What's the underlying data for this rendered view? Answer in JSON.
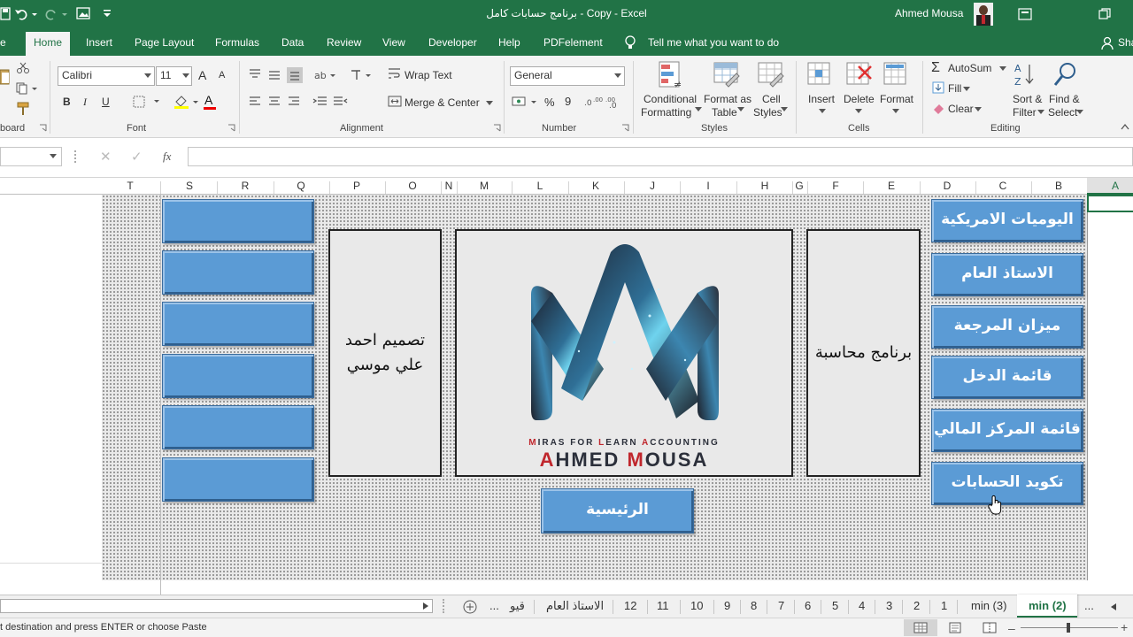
{
  "window": {
    "title": "برنامج حسابات كامل - Copy  -  Excel",
    "user": "Ahmed Mousa"
  },
  "menu": {
    "tabs": [
      "Home",
      "Insert",
      "Page Layout",
      "Formulas",
      "Data",
      "Review",
      "View",
      "Developer",
      "Help",
      "PDFelement"
    ],
    "tell_me": "Tell me what you want to do",
    "share": "Sha"
  },
  "ribbon": {
    "clipboard": {
      "label": "board"
    },
    "font": {
      "name": "Calibri",
      "size": "11",
      "label": "Font",
      "bold": "B",
      "italic": "I",
      "underline": "U",
      "grow": "A",
      "shrink": "A",
      "font_color": "A"
    },
    "alignment": {
      "wrap_text": "Wrap Text",
      "merge_center": "Merge & Center",
      "label": "Alignment"
    },
    "number": {
      "format": "General",
      "percent": "%",
      "comma": "9",
      "label": "Number"
    },
    "styles": {
      "conditional_1": "Conditional",
      "conditional_2": "Formatting",
      "format_table_1": "Format as",
      "format_table_2": "Table",
      "cell_styles_1": "Cell",
      "cell_styles_2": "Styles",
      "label": "Styles"
    },
    "cells": {
      "insert": "Insert",
      "delete": "Delete",
      "format": "Format",
      "label": "Cells"
    },
    "editing": {
      "autosum": "AutoSum",
      "fill": "Fill",
      "clear": "Clear",
      "sort_1": "Sort &",
      "sort_2": "Filter",
      "find_1": "Find &",
      "find_2": "Select",
      "label": "Editing"
    }
  },
  "formula_bar": {
    "fx": "fx",
    "value": ""
  },
  "columns": [
    "T",
    "S",
    "R",
    "Q",
    "P",
    "O",
    "N",
    "M",
    "L",
    "K",
    "J",
    "I",
    "H",
    "G",
    "F",
    "E",
    "D",
    "C",
    "B",
    "A"
  ],
  "sheet": {
    "nav_buttons": [
      "اليوميات الامريكية",
      "الاستاذ العام",
      "ميزان المرجعة",
      "قائمة الدخل",
      "قائمة المركز المالي",
      "تكويد الحسابات"
    ],
    "main_button": "الرئيسية",
    "designer_line1": "تصميم احمد",
    "designer_line2": "علي موسي",
    "program_label": "برنامج محاسبة",
    "logo": {
      "tagline_parts": [
        "M",
        "IRAS FOR ",
        "L",
        "EARN ",
        "A",
        "CCOUNTING"
      ],
      "name_parts": [
        "A",
        "HMED ",
        "M",
        "OUSA"
      ],
      "colors": {
        "accent_red": "#c0272d",
        "dark": "#2b2f3a",
        "cyan": "#6fd3ee"
      }
    }
  },
  "sheet_tabs": {
    "items": [
      "قيو",
      "الاستاذ العام",
      "12",
      "11",
      "10",
      "9",
      "8",
      "7",
      "6",
      "5",
      "4",
      "3",
      "2",
      "1",
      "min (3)",
      "min (2)"
    ],
    "active": "min (2)",
    "more_left": "...",
    "more_right": "..."
  },
  "status": {
    "message": "t destination and press ENTER or choose Paste"
  },
  "colors": {
    "excel_green": "#217346",
    "button_blue": "#5b9bd5"
  }
}
